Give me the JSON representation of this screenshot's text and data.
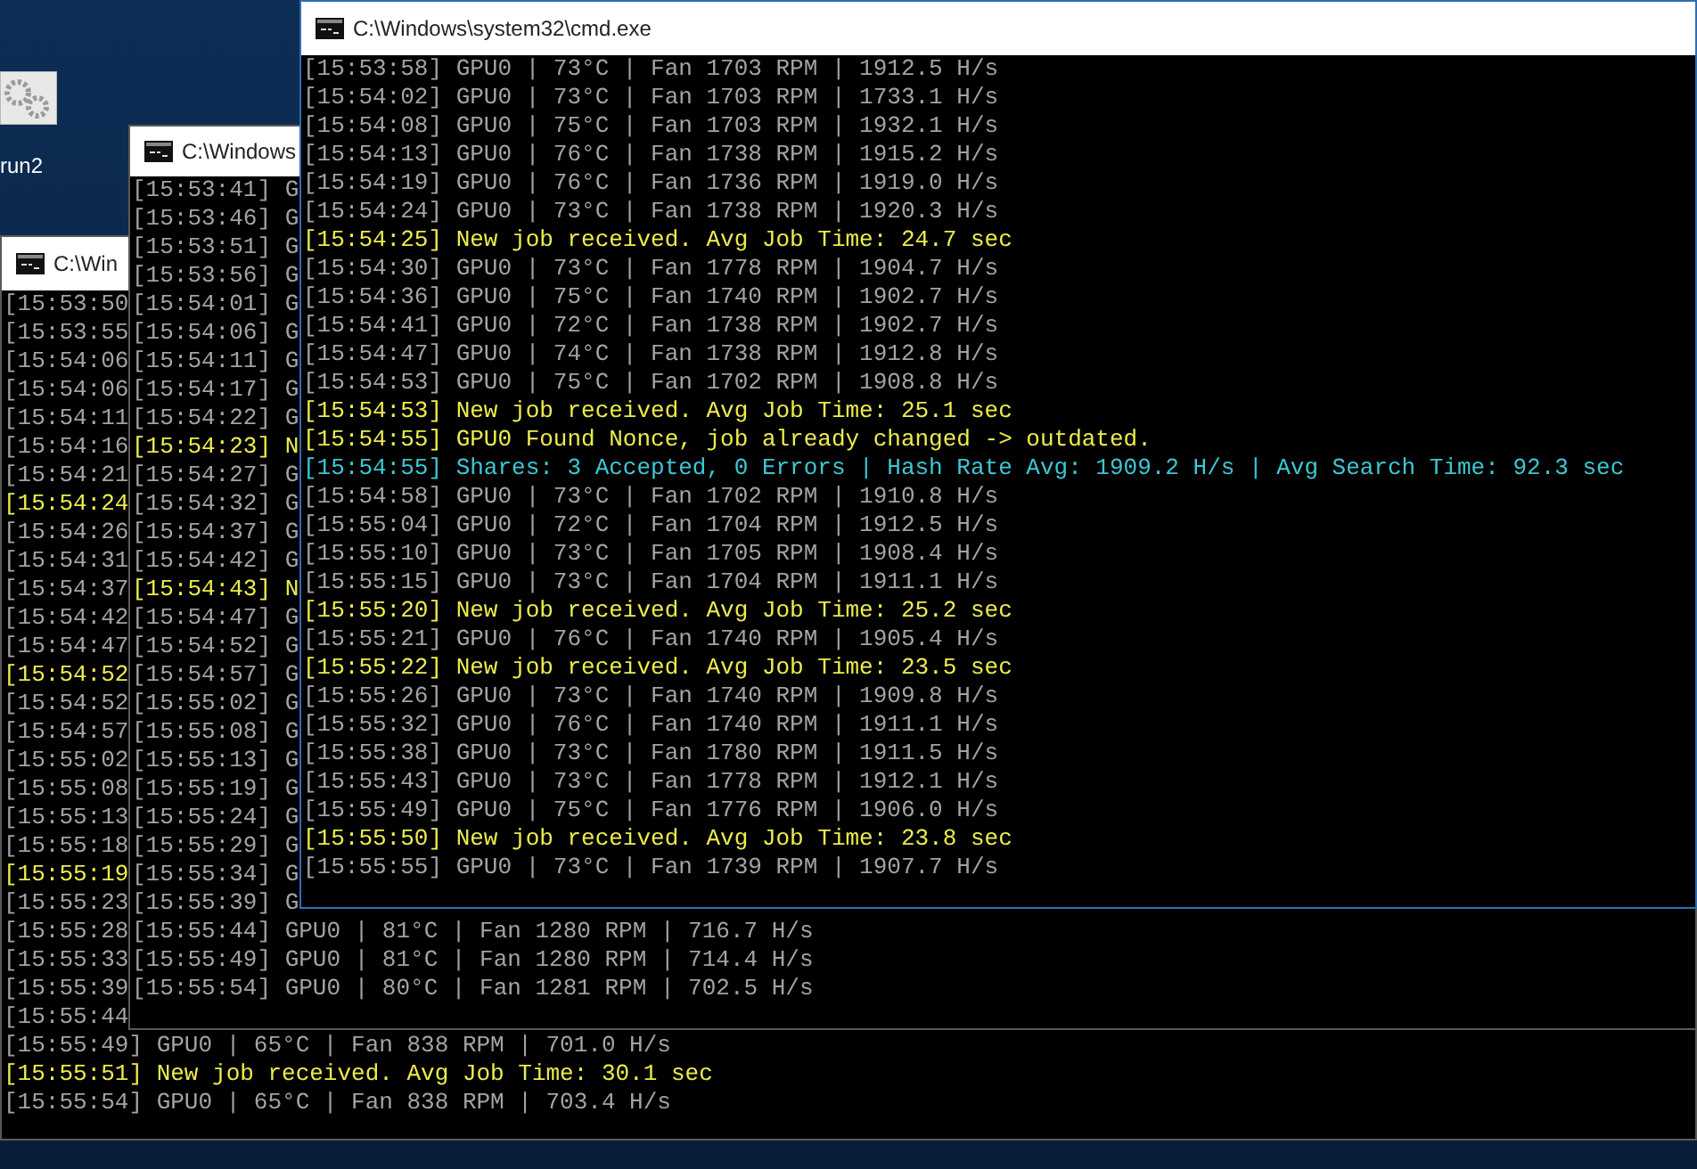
{
  "desktop": {
    "icons": [
      {
        "label": "run2"
      }
    ]
  },
  "windows": [
    {
      "title": "C:\\Win",
      "lines": [
        {
          "kind": "status",
          "text": "[15:53:50"
        },
        {
          "kind": "status",
          "text": "[15:53:55"
        },
        {
          "kind": "status",
          "text": "[15:54:06"
        },
        {
          "kind": "status",
          "text": "[15:54:06"
        },
        {
          "kind": "status",
          "text": "[15:54:11"
        },
        {
          "kind": "status",
          "text": "[15:54:16"
        },
        {
          "kind": "status",
          "text": "[15:54:21"
        },
        {
          "kind": "job",
          "text": "[15:54:24"
        },
        {
          "kind": "status",
          "text": "[15:54:26"
        },
        {
          "kind": "status",
          "text": "[15:54:31"
        },
        {
          "kind": "status",
          "text": "[15:54:37"
        },
        {
          "kind": "status",
          "text": "[15:54:42"
        },
        {
          "kind": "status",
          "text": "[15:54:47"
        },
        {
          "kind": "job",
          "text": "[15:54:52"
        },
        {
          "kind": "status",
          "text": "[15:54:52"
        },
        {
          "kind": "status",
          "text": "[15:54:57"
        },
        {
          "kind": "status",
          "text": "[15:55:02"
        },
        {
          "kind": "status",
          "text": "[15:55:08"
        },
        {
          "kind": "status",
          "text": "[15:55:13"
        },
        {
          "kind": "status",
          "text": "[15:55:18"
        },
        {
          "kind": "job",
          "text": "[15:55:19"
        },
        {
          "kind": "status",
          "text": "[15:55:23"
        },
        {
          "kind": "status",
          "text": "[15:55:28"
        },
        {
          "kind": "status",
          "text": "[15:55:33"
        },
        {
          "kind": "status",
          "text": "[15:55:39"
        },
        {
          "kind": "status",
          "text": "[15:55:44"
        },
        {
          "kind": "status",
          "text": "[15:55:49] GPU0 | 65°C | Fan 838 RPM | 701.0 H/s"
        },
        {
          "kind": "job",
          "text": "[15:55:51] New job received. Avg Job Time: 30.1 sec"
        },
        {
          "kind": "status",
          "text": "[15:55:54] GPU0 | 65°C | Fan 838 RPM | 703.4 H/s"
        }
      ]
    },
    {
      "title": "C:\\Windows",
      "lines": [
        {
          "kind": "status",
          "text": "[15:53:41] G"
        },
        {
          "kind": "status",
          "text": "[15:53:46] G"
        },
        {
          "kind": "status",
          "text": "[15:53:51] G"
        },
        {
          "kind": "status",
          "text": "[15:53:56] G"
        },
        {
          "kind": "status",
          "text": "[15:54:01] G"
        },
        {
          "kind": "status",
          "text": "[15:54:06] G"
        },
        {
          "kind": "status",
          "text": "[15:54:11] G"
        },
        {
          "kind": "status",
          "text": "[15:54:17] G"
        },
        {
          "kind": "status",
          "text": "[15:54:22] G"
        },
        {
          "kind": "job",
          "text": "[15:54:23] N"
        },
        {
          "kind": "status",
          "text": "[15:54:27] G"
        },
        {
          "kind": "status",
          "text": "[15:54:32] G"
        },
        {
          "kind": "status",
          "text": "[15:54:37] G"
        },
        {
          "kind": "status",
          "text": "[15:54:42] G"
        },
        {
          "kind": "job",
          "text": "[15:54:43] N"
        },
        {
          "kind": "status",
          "text": "[15:54:47] G"
        },
        {
          "kind": "status",
          "text": "[15:54:52] G"
        },
        {
          "kind": "status",
          "text": "[15:54:57] G"
        },
        {
          "kind": "status",
          "text": "[15:55:02] G"
        },
        {
          "kind": "status",
          "text": "[15:55:08] G"
        },
        {
          "kind": "status",
          "text": "[15:55:13] G"
        },
        {
          "kind": "status",
          "text": "[15:55:19] G"
        },
        {
          "kind": "status",
          "text": "[15:55:24] G"
        },
        {
          "kind": "status",
          "text": "[15:55:29] G"
        },
        {
          "kind": "status",
          "text": "[15:55:34] G"
        },
        {
          "kind": "status",
          "text": "[15:55:39] G"
        },
        {
          "kind": "status",
          "text": "[15:55:44] GPU0 | 81°C | Fan 1280 RPM | 716.7 H/s"
        },
        {
          "kind": "status",
          "text": "[15:55:49] GPU0 | 81°C | Fan 1280 RPM | 714.4 H/s"
        },
        {
          "kind": "status",
          "text": "[15:55:54] GPU0 | 80°C | Fan 1281 RPM | 702.5 H/s"
        }
      ]
    },
    {
      "title": "C:\\Windows\\system32\\cmd.exe",
      "lines": [
        {
          "kind": "status",
          "text": "[15:53:58] GPU0 | 73°C | Fan 1703 RPM | 1912.5 H/s"
        },
        {
          "kind": "status",
          "text": "[15:54:02] GPU0 | 73°C | Fan 1703 RPM | 1733.1 H/s"
        },
        {
          "kind": "status",
          "text": "[15:54:08] GPU0 | 75°C | Fan 1703 RPM | 1932.1 H/s"
        },
        {
          "kind": "status",
          "text": "[15:54:13] GPU0 | 76°C | Fan 1738 RPM | 1915.2 H/s"
        },
        {
          "kind": "status",
          "text": "[15:54:19] GPU0 | 76°C | Fan 1736 RPM | 1919.0 H/s"
        },
        {
          "kind": "status",
          "text": "[15:54:24] GPU0 | 73°C | Fan 1738 RPM | 1920.3 H/s"
        },
        {
          "kind": "job",
          "text": "[15:54:25] New job received. Avg Job Time: 24.7 sec"
        },
        {
          "kind": "status",
          "text": "[15:54:30] GPU0 | 73°C | Fan 1778 RPM | 1904.7 H/s"
        },
        {
          "kind": "status",
          "text": "[15:54:36] GPU0 | 75°C | Fan 1740 RPM | 1902.7 H/s"
        },
        {
          "kind": "status",
          "text": "[15:54:41] GPU0 | 72°C | Fan 1738 RPM | 1902.7 H/s"
        },
        {
          "kind": "status",
          "text": "[15:54:47] GPU0 | 74°C | Fan 1738 RPM | 1912.8 H/s"
        },
        {
          "kind": "status",
          "text": "[15:54:53] GPU0 | 75°C | Fan 1702 RPM | 1908.8 H/s"
        },
        {
          "kind": "job",
          "text": "[15:54:53] New job received. Avg Job Time: 25.1 sec"
        },
        {
          "kind": "job",
          "text": "[15:54:55] GPU0 Found Nonce, job already changed -> outdated."
        },
        {
          "kind": "shares",
          "text": "[15:54:55] Shares: 3 Accepted, 0 Errors | Hash Rate Avg: 1909.2 H/s | Avg Search Time: 92.3 sec"
        },
        {
          "kind": "status",
          "text": "[15:54:58] GPU0 | 73°C | Fan 1702 RPM | 1910.8 H/s"
        },
        {
          "kind": "status",
          "text": "[15:55:04] GPU0 | 72°C | Fan 1704 RPM | 1912.5 H/s"
        },
        {
          "kind": "status",
          "text": "[15:55:10] GPU0 | 73°C | Fan 1705 RPM | 1908.4 H/s"
        },
        {
          "kind": "status",
          "text": "[15:55:15] GPU0 | 73°C | Fan 1704 RPM | 1911.1 H/s"
        },
        {
          "kind": "job",
          "text": "[15:55:20] New job received. Avg Job Time: 25.2 sec"
        },
        {
          "kind": "status",
          "text": "[15:55:21] GPU0 | 76°C | Fan 1740 RPM | 1905.4 H/s"
        },
        {
          "kind": "job",
          "text": "[15:55:22] New job received. Avg Job Time: 23.5 sec"
        },
        {
          "kind": "status",
          "text": "[15:55:26] GPU0 | 73°C | Fan 1740 RPM | 1909.8 H/s"
        },
        {
          "kind": "status",
          "text": "[15:55:32] GPU0 | 76°C | Fan 1740 RPM | 1911.1 H/s"
        },
        {
          "kind": "status",
          "text": "[15:55:38] GPU0 | 73°C | Fan 1780 RPM | 1911.5 H/s"
        },
        {
          "kind": "status",
          "text": "[15:55:43] GPU0 | 73°C | Fan 1778 RPM | 1912.1 H/s"
        },
        {
          "kind": "status",
          "text": "[15:55:49] GPU0 | 75°C | Fan 1776 RPM | 1906.0 H/s"
        },
        {
          "kind": "job",
          "text": "[15:55:50] New job received. Avg Job Time: 23.8 sec"
        },
        {
          "kind": "status",
          "text": "[15:55:55] GPU0 | 73°C | Fan 1739 RPM | 1907.7 H/s"
        }
      ]
    }
  ]
}
